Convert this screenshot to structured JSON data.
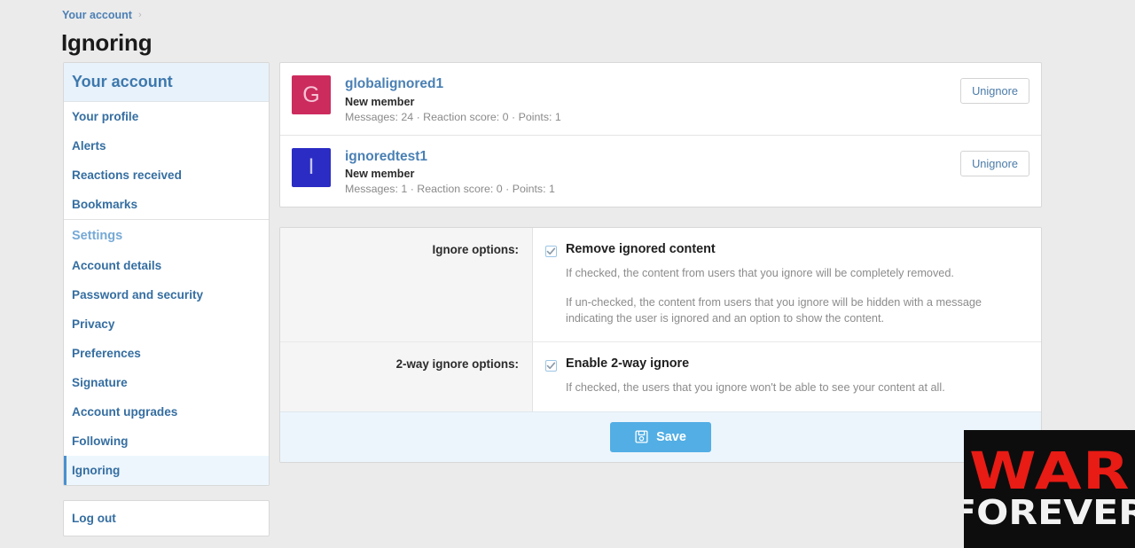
{
  "breadcrumb": {
    "link": "Your account",
    "separator": "›"
  },
  "page_title": "Ignoring",
  "sidebar": {
    "header": "Your account",
    "items": [
      {
        "label": "Your profile",
        "active": false
      },
      {
        "label": "Alerts",
        "active": false
      },
      {
        "label": "Reactions received",
        "active": false
      },
      {
        "label": "Bookmarks",
        "active": false
      }
    ],
    "settings_label": "Settings",
    "settings_items": [
      {
        "label": "Account details",
        "active": false
      },
      {
        "label": "Password and security",
        "active": false
      },
      {
        "label": "Privacy",
        "active": false
      },
      {
        "label": "Preferences",
        "active": false
      },
      {
        "label": "Signature",
        "active": false
      },
      {
        "label": "Account upgrades",
        "active": false
      },
      {
        "label": "Following",
        "active": false
      },
      {
        "label": "Ignoring",
        "active": true
      }
    ],
    "logout": "Log out"
  },
  "ignored_users": [
    {
      "initial": "G",
      "avatar_color": "#cc2b5e",
      "username": "globalignored1",
      "user_title": "New member",
      "stats": "Messages: 24 · Reaction score: 0 · Points: 1",
      "action_label": "Unignore"
    },
    {
      "initial": "I",
      "avatar_color": "#2b2cc4",
      "username": "ignoredtest1",
      "user_title": "New member",
      "stats": "Messages: 1 · Reaction score: 0 · Points: 1",
      "action_label": "Unignore"
    }
  ],
  "form": {
    "ignore_options": {
      "label": "Ignore options:",
      "checkbox_label": "Remove ignored content",
      "checked": true,
      "hint_1": "If checked, the content from users that you ignore will be completely removed.",
      "hint_2": "If un-checked, the content from users that you ignore will be hidden with a message indicating the user is ignored and an option to show the content."
    },
    "two_way_options": {
      "label": "2-way ignore options:",
      "checkbox_label": "Enable 2-way ignore",
      "checked": true,
      "hint_1": "If checked, the users that you ignore won't be able to see your content at all."
    },
    "save_label": "Save"
  },
  "watermark": {
    "line1": "WAR",
    "line2": "FOREVER"
  },
  "colors": {
    "accent_blue": "#4a80b4",
    "save_blue": "#52aee4",
    "active_item_bg": "#edf6fd",
    "page_bg": "#ebebeb",
    "watermark_red": "#e81b15"
  }
}
